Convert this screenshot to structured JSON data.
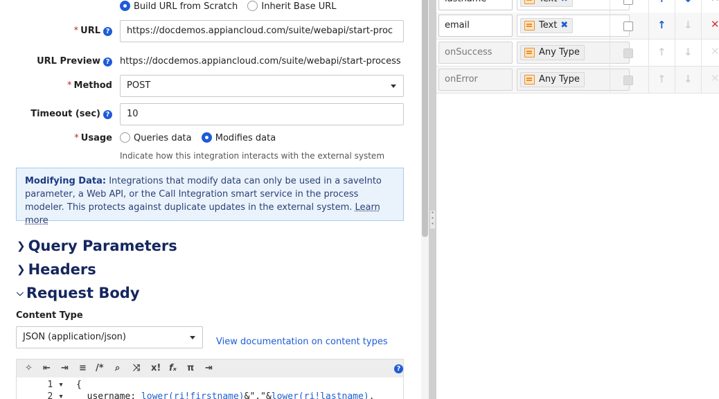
{
  "url_mode": {
    "option_scratch": "Build URL from Scratch",
    "option_inherit": "Inherit Base URL",
    "selected": "scratch"
  },
  "url": {
    "label": "URL",
    "value": "https://docdemos.appiancloud.com/suite/webapi/start-proc"
  },
  "url_preview": {
    "label": "URL Preview",
    "value": "https://docdemos.appiancloud.com/suite/webapi/start-process"
  },
  "method": {
    "label": "Method",
    "value": "POST"
  },
  "timeout": {
    "label": "Timeout (sec)",
    "value": "10"
  },
  "usage": {
    "label": "Usage",
    "option_queries": "Queries data",
    "option_modifies": "Modifies data",
    "selected": "modifies",
    "hint": "Indicate how this integration interacts with the external system"
  },
  "info_box": {
    "bold": "Modifying Data:",
    "text": " Integrations that modify data can only be used in a saveInto parameter, a Web API, or the Call Integration smart service in the process modeler. This protects against duplicate updates in the external system. ",
    "link": "Learn more"
  },
  "sections": {
    "query_params": "Query Parameters",
    "headers": "Headers",
    "request_body": "Request Body"
  },
  "content_type": {
    "label": "Content Type",
    "value": "JSON (application/json)",
    "doc_link": "View documentation on content types"
  },
  "editor": {
    "lines": [
      {
        "num": "1",
        "text": "{"
      },
      {
        "num": "2",
        "pre": "  username: ",
        "fn1": "lower(ri!firstname)",
        "mid": "&\".\"&",
        "fn2": "lower(ri!lastname)",
        "post": ","
      }
    ]
  },
  "rule_inputs": {
    "rows": [
      {
        "name": "lastname",
        "type": "Text",
        "removable": true,
        "enabled": true
      },
      {
        "name": "email",
        "type": "Text",
        "removable": true,
        "enabled": true
      },
      {
        "name": "onSuccess",
        "type": "Any Type",
        "removable": false,
        "enabled": false
      },
      {
        "name": "onError",
        "type": "Any Type",
        "removable": false,
        "enabled": false
      }
    ]
  },
  "colors": {
    "accent": "#1e5bd8",
    "heading": "#14265e",
    "required": "#c0262d",
    "info_bg": "#eaf3fc",
    "delete": "#d13438"
  }
}
